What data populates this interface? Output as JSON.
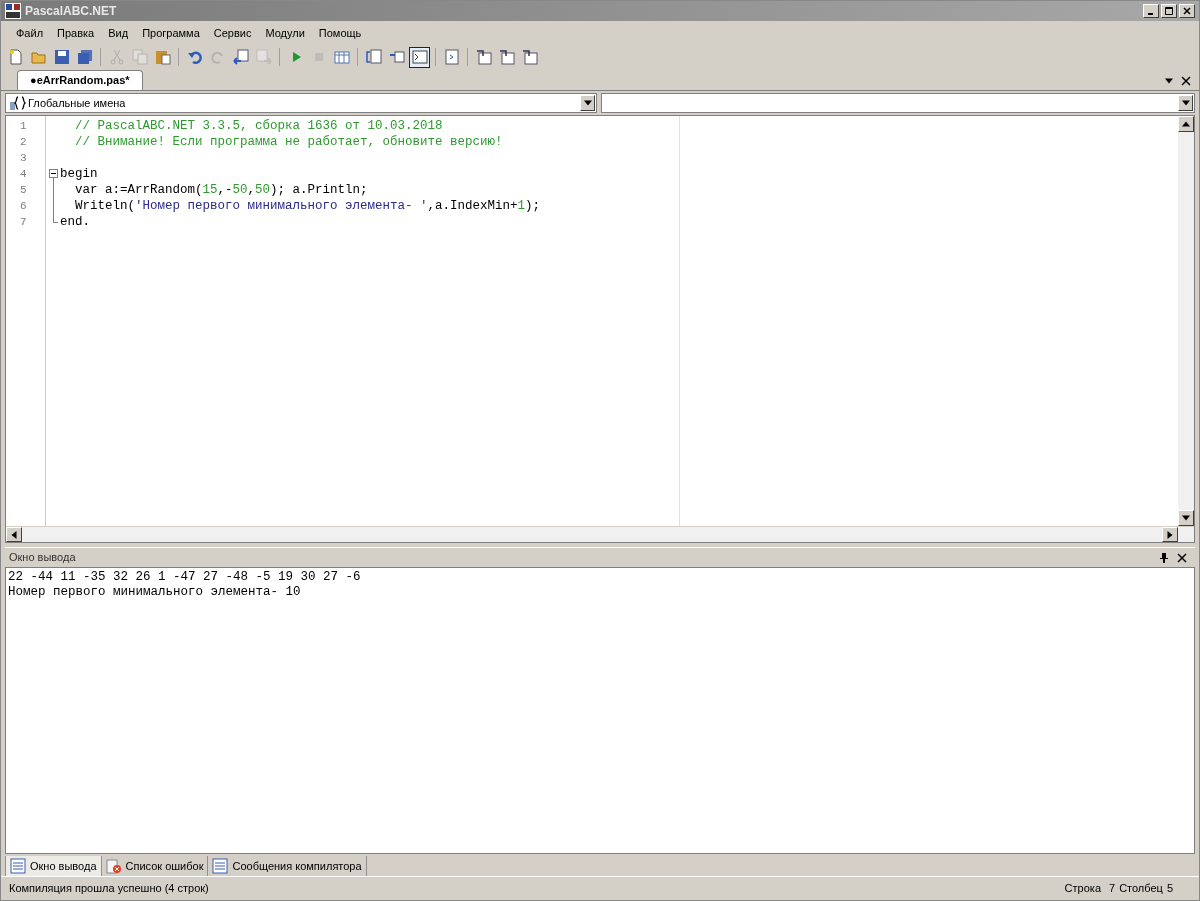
{
  "window": {
    "title": "PascalABC.NET"
  },
  "menu": [
    "Файл",
    "Правка",
    "Вид",
    "Программа",
    "Сервис",
    "Модули",
    "Помощь"
  ],
  "toolbar": [
    {
      "kind": "new",
      "disabled": false,
      "selected": false
    },
    {
      "kind": "open",
      "disabled": false,
      "selected": false
    },
    {
      "kind": "save",
      "disabled": false,
      "selected": false
    },
    {
      "kind": "save-all",
      "disabled": false,
      "selected": false
    },
    {
      "kind": "separator"
    },
    {
      "kind": "cut",
      "disabled": true,
      "selected": false
    },
    {
      "kind": "copy",
      "disabled": true,
      "selected": false
    },
    {
      "kind": "paste",
      "disabled": false,
      "selected": false
    },
    {
      "kind": "separator"
    },
    {
      "kind": "undo",
      "disabled": false,
      "selected": false
    },
    {
      "kind": "redo",
      "disabled": true,
      "selected": false
    },
    {
      "kind": "back",
      "disabled": false,
      "selected": false
    },
    {
      "kind": "forward",
      "disabled": true,
      "selected": false
    },
    {
      "kind": "separator"
    },
    {
      "kind": "run",
      "disabled": false,
      "selected": false
    },
    {
      "kind": "stop",
      "disabled": true,
      "selected": false
    },
    {
      "kind": "build",
      "disabled": false,
      "selected": false
    },
    {
      "kind": "separator"
    },
    {
      "kind": "doc-left",
      "disabled": false,
      "selected": false
    },
    {
      "kind": "doc-right",
      "disabled": false,
      "selected": false
    },
    {
      "kind": "console",
      "disabled": false,
      "selected": true
    },
    {
      "kind": "separator"
    },
    {
      "kind": "panel",
      "disabled": false,
      "selected": false
    },
    {
      "kind": "separator"
    },
    {
      "kind": "debug",
      "disabled": false,
      "selected": false
    },
    {
      "kind": "debug",
      "disabled": false,
      "selected": false
    },
    {
      "kind": "debug",
      "disabled": false,
      "selected": false
    }
  ],
  "document_tabs": [
    {
      "label": "●eArrRandom.pas*",
      "selected": true
    }
  ],
  "scope_selector": {
    "value": "Глобальные имена"
  },
  "editor": {
    "lines": [
      {
        "number": "1",
        "kind": "plain",
        "tokens": [
          {
            "kind": "comment",
            "text": "  // PascalABC.NET 3.3.5, сборка 1636 от 10.03.2018"
          }
        ]
      },
      {
        "number": "2",
        "kind": "plain",
        "tokens": [
          {
            "kind": "comment",
            "text": "  // Внимание! Если программа не работает, обновите версию!"
          }
        ]
      },
      {
        "number": "3",
        "kind": "plain"
      },
      {
        "number": "4",
        "kind": "fold-start",
        "tokens": [
          {
            "kind": "plain",
            "text": "begin"
          }
        ]
      },
      {
        "number": "5",
        "kind": "fold-inside",
        "tokens": [
          {
            "kind": "plain",
            "text": "  var a:=ArrRandom("
          },
          {
            "kind": "number",
            "text": "15"
          },
          {
            "kind": "plain",
            "text": ",-"
          },
          {
            "kind": "number",
            "text": "50"
          },
          {
            "kind": "plain",
            "text": ","
          },
          {
            "kind": "number",
            "text": "50"
          },
          {
            "kind": "plain",
            "text": "); a.Println;"
          }
        ]
      },
      {
        "number": "6",
        "kind": "fold-inside",
        "tokens": [
          {
            "kind": "plain",
            "text": "  Writeln("
          },
          {
            "kind": "string",
            "text": "'Номер первого минимального элемента- '"
          },
          {
            "kind": "plain",
            "text": ",a.IndexMin+"
          },
          {
            "kind": "number",
            "text": "1"
          },
          {
            "kind": "plain",
            "text": ");"
          }
        ]
      },
      {
        "number": "7",
        "kind": "fold-end",
        "tokens": [
          {
            "kind": "plain",
            "text": "end."
          }
        ]
      }
    ]
  },
  "output_panel": {
    "title": "Окно вывода",
    "lines": [
      "22 -44 11 -35 32 26 1 -47 27 -48 -5 19 30 27 -6",
      "Номер первого минимального элемента- 10"
    ]
  },
  "bottom_tabs": [
    {
      "label": "Окно вывода",
      "kind": "list",
      "selected": true
    },
    {
      "label": "Список ошибок",
      "kind": "errors",
      "selected": false
    },
    {
      "label": "Сообщения компилятора",
      "kind": "list",
      "selected": false
    }
  ],
  "status_bar": {
    "message": "Компиляция прошла успешно (4 строк)",
    "line_label": "Строка",
    "line": "7",
    "column_label": "Столбец",
    "column": "5"
  }
}
